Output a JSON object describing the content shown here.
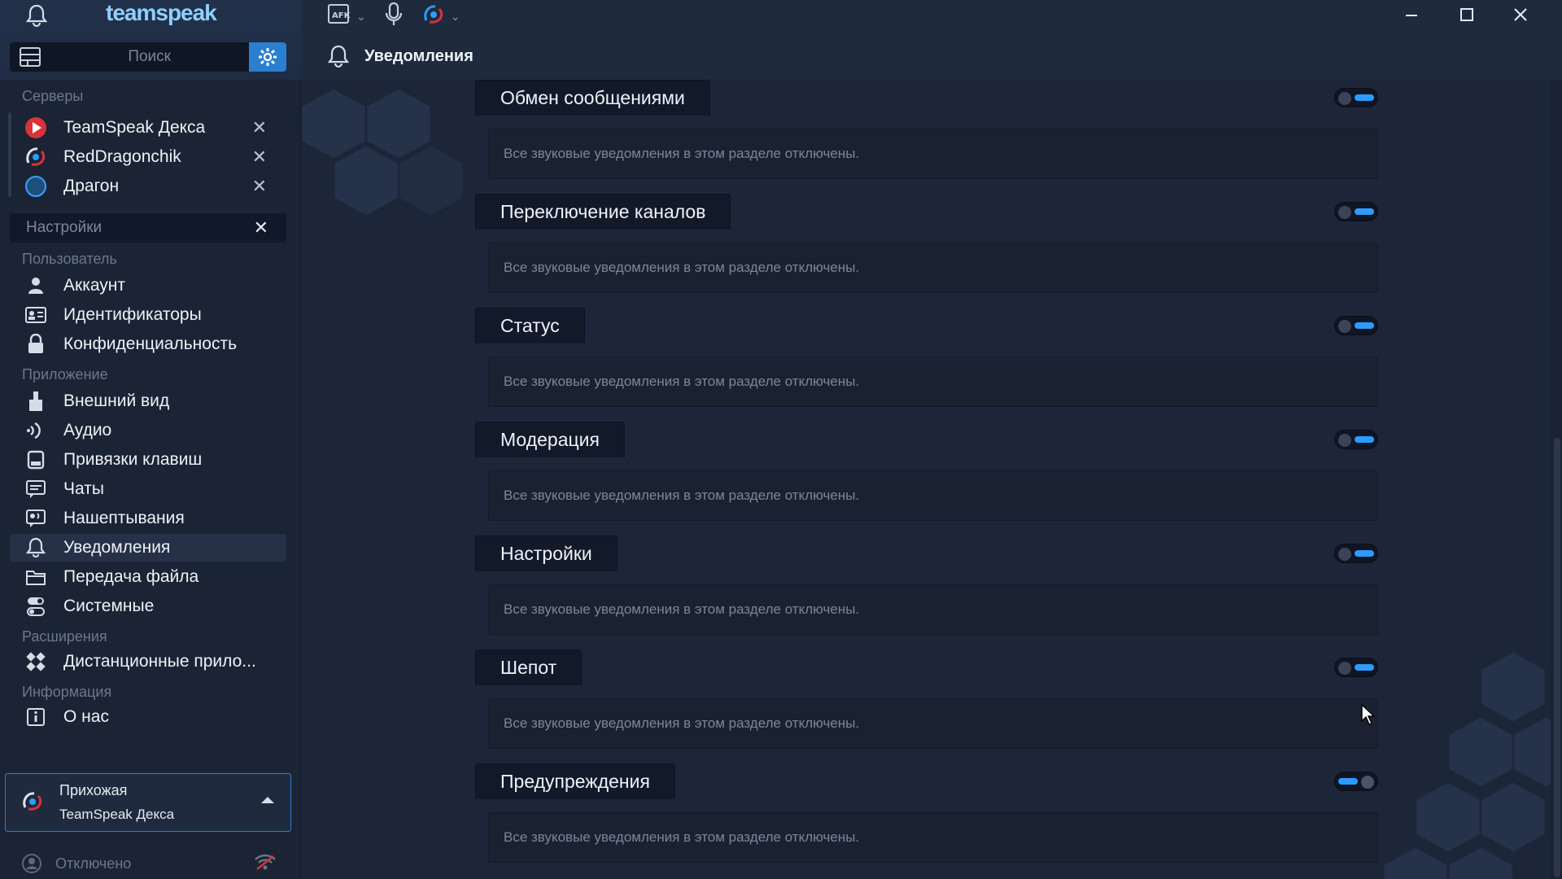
{
  "app": {
    "logo": "teamspeak"
  },
  "search": {
    "placeholder": "Поиск"
  },
  "sidebar": {
    "servers_label": "Серверы",
    "servers": [
      {
        "name": "TeamSpeak Декса",
        "icon": "server-red-icon"
      },
      {
        "name": "RedDragonchik",
        "icon": "teamspeak-icon"
      },
      {
        "name": "Драгон",
        "icon": "circle-blue-icon"
      }
    ],
    "settings_label": "Настройки",
    "user_label": "Пользователь",
    "user_items": [
      "Аккаунт",
      "Идентификаторы",
      "Конфиденциальность"
    ],
    "app_label": "Приложение",
    "app_items": [
      "Внешний вид",
      "Аудио",
      "Привязки клавиш",
      "Чаты",
      "Нашептывания",
      "Уведомления",
      "Передача файла",
      "Системные"
    ],
    "ext_label": "Расширения",
    "ext_items": [
      "Дистанционные прило..."
    ],
    "info_label": "Информация",
    "info_items": [
      "О нас"
    ],
    "connection": {
      "channel": "Прихожая",
      "server": "TeamSpeak Декса"
    },
    "status": "Отключено"
  },
  "titlebar": {
    "page_title": "Уведомления",
    "toolbar_icons": [
      "afk-icon",
      "microphone-icon",
      "teamspeak-icon"
    ]
  },
  "groups": [
    {
      "title": "Обмен сообщениями",
      "note": "Все звуковые уведомления в этом разделе отключены.",
      "enabled": false
    },
    {
      "title": "Переключение каналов",
      "note": "Все звуковые уведомления в этом разделе отключены.",
      "enabled": false
    },
    {
      "title": "Статус",
      "note": "Все звуковые уведомления в этом разделе отключены.",
      "enabled": false
    },
    {
      "title": "Модерация",
      "note": "Все звуковые уведомления в этом разделе отключены.",
      "enabled": false
    },
    {
      "title": "Настройки",
      "note": "Все звуковые уведомления в этом разделе отключены.",
      "enabled": false
    },
    {
      "title": "Шепот",
      "note": "Все звуковые уведомления в этом разделе отключены.",
      "enabled": false
    },
    {
      "title": "Предупреждения",
      "note": "Все звуковые уведомления в этом разделе отключены.",
      "enabled": true
    }
  ],
  "colors": {
    "accent": "#2e9bff",
    "bg": "#1d2639",
    "sidebar": "#1b2434"
  }
}
